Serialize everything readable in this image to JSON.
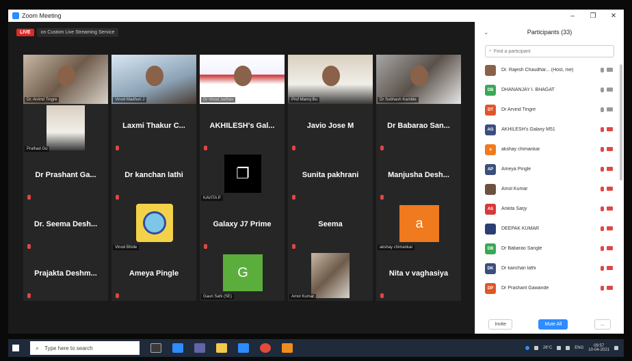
{
  "window": {
    "title": "Zoom Meeting"
  },
  "live": {
    "badge": "LIVE",
    "text": "on Custom Live Streaming Service"
  },
  "tiles": [
    {
      "name": "",
      "label": "Dr. Arvind Tingre",
      "kind": "video",
      "photo": "photo-a"
    },
    {
      "name": "",
      "label": "Vinod Madhuri J",
      "kind": "video",
      "photo": "photo-b",
      "active": true
    },
    {
      "name": "",
      "label": "Dr Vinod Jadhav",
      "kind": "video",
      "photo": "photo-c"
    },
    {
      "name": "",
      "label": "Prof Manoj Bu",
      "kind": "video",
      "photo": "photo-d"
    },
    {
      "name": "",
      "label": "Dr Subhash Kamble",
      "kind": "video",
      "photo": "photo-e"
    },
    {
      "name": "",
      "label": "Pralhad Gu",
      "kind": "photo-small"
    },
    {
      "name": "Laxmi Thakur C...",
      "label": "",
      "kind": "name"
    },
    {
      "name": "AKHILESH's Gal...",
      "label": "",
      "kind": "name"
    },
    {
      "name": "Javio Jose M",
      "label": "",
      "kind": "name"
    },
    {
      "name": "Dr Babarao San...",
      "label": "",
      "kind": "name"
    },
    {
      "name": "Dr Prashant Ga...",
      "label": "",
      "kind": "name"
    },
    {
      "name": "Dr kanchan lathi",
      "label": "",
      "kind": "name"
    },
    {
      "name": "",
      "label": "KAVITA P",
      "kind": "icon-black"
    },
    {
      "name": "Sunita pakhrani",
      "label": "",
      "kind": "name"
    },
    {
      "name": "Manjusha Desh...",
      "label": "",
      "kind": "name"
    },
    {
      "name": "Dr. Seema Desh...",
      "label": "",
      "kind": "name"
    },
    {
      "name": "",
      "label": "Vinod Bhide",
      "kind": "logo-yellow"
    },
    {
      "name": "Galaxy J7 Prime",
      "label": "",
      "kind": "name"
    },
    {
      "name": "Seema",
      "label": "",
      "kind": "name"
    },
    {
      "name": "",
      "label": "akshay chimankar",
      "kind": "letter",
      "letter": "a",
      "color": "#f07a1e"
    },
    {
      "name": "Prajakta Deshm...",
      "label": "",
      "kind": "name"
    },
    {
      "name": "Ameya Pingle",
      "label": "",
      "kind": "name"
    },
    {
      "name": "",
      "label": "Gauri Sahi (SE)",
      "kind": "letter",
      "letter": "G",
      "color": "#5cae3c"
    },
    {
      "name": "",
      "label": "Amol Kumar",
      "kind": "photo-small2"
    },
    {
      "name": "Nita v vaghasiya",
      "label": "",
      "kind": "name"
    }
  ],
  "panel": {
    "title": "Participants (33)",
    "search_placeholder": "Find a participant",
    "participants": [
      {
        "initials": "",
        "color": "#8a6249",
        "name": "Dr. Rajesh Chaudhar... (Host, me)",
        "mic": "on",
        "cam": "on"
      },
      {
        "initials": "DB",
        "color": "#3aa857",
        "name": "DHANANJAY I. BHAGAT",
        "mic": "on",
        "cam": "on"
      },
      {
        "initials": "DT",
        "color": "#e0562a",
        "name": "Dr Arvind Tingre",
        "mic": "on",
        "cam": "on"
      },
      {
        "initials": "AG",
        "color": "#3b4e7d",
        "name": "AKHILESH's Galaxy M51",
        "mic": "off",
        "cam": "off"
      },
      {
        "initials": "a",
        "color": "#f07a1e",
        "name": "akshay chimankar",
        "mic": "off",
        "cam": "off"
      },
      {
        "initials": "AP",
        "color": "#3b4e7d",
        "name": "Ameya Pingle",
        "mic": "off",
        "cam": "off"
      },
      {
        "initials": "",
        "color": "#6d5140",
        "name": "Amol Kumar",
        "mic": "off",
        "cam": "off"
      },
      {
        "initials": "AS",
        "color": "#d73a3a",
        "name": "Ankita Sarjy",
        "mic": "off",
        "cam": "off"
      },
      {
        "initials": "",
        "color": "#2c3e73",
        "name": "DEEPAK KUMAR",
        "mic": "off",
        "cam": "off"
      },
      {
        "initials": "DB",
        "color": "#3aa857",
        "name": "Dr Babarao Sangle",
        "mic": "off",
        "cam": "off"
      },
      {
        "initials": "DK",
        "color": "#3b4e7d",
        "name": "Dr kanchan lathi",
        "mic": "off",
        "cam": "off"
      },
      {
        "initials": "DP",
        "color": "#e0562a",
        "name": "Dr Prashant Gawande",
        "mic": "off",
        "cam": "off"
      }
    ],
    "invite_label": "Invite",
    "mute_all_label": "Mute All",
    "more_label": "..."
  },
  "taskbar": {
    "search_placeholder": "Type here to search",
    "temp": "26°C",
    "lang": "ENG",
    "time": "09:57",
    "date": "10-04-2021"
  }
}
